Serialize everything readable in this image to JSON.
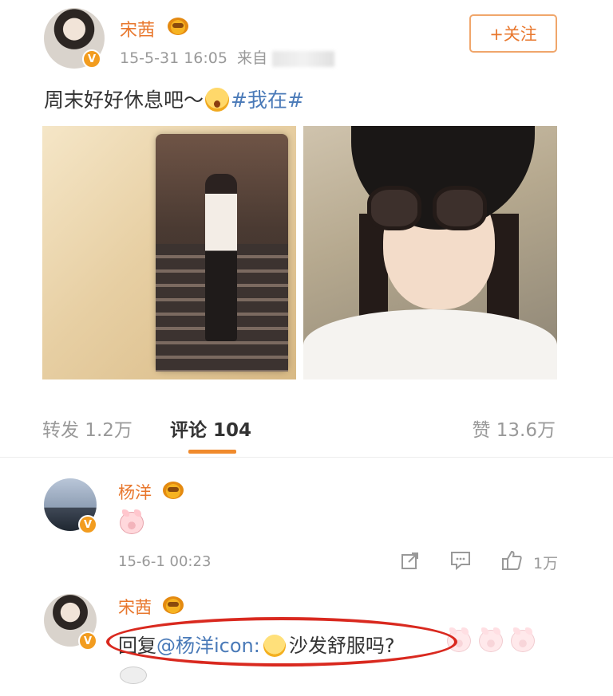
{
  "post": {
    "author": "宋茜",
    "time": "15-5-31 16:05",
    "source_prefix": "来自",
    "follow_label": "+关注",
    "text_before": "周末好好休息吧～",
    "hashtag": "#我在#",
    "author_badge": "V"
  },
  "stats": {
    "forward_label": "转发 1.2万",
    "comment_label": "评论 104",
    "like_label": "赞 13.6万"
  },
  "comments": [
    {
      "author": "杨洋",
      "time": "15-6-1 00:23",
      "like_count": "1万",
      "badge": "V"
    },
    {
      "author": "宋茜",
      "reply_prefix": "回复",
      "mention": "@杨洋icon:",
      "reply_text": "沙发舒服吗?",
      "badge": "V"
    }
  ],
  "icons": {
    "forward": "share-icon",
    "comment": "comment-icon",
    "like": "thumbs-up-icon"
  },
  "colors": {
    "accent": "#e8772d",
    "link": "#4a7ab8",
    "highlight_oval": "#d9291f"
  }
}
